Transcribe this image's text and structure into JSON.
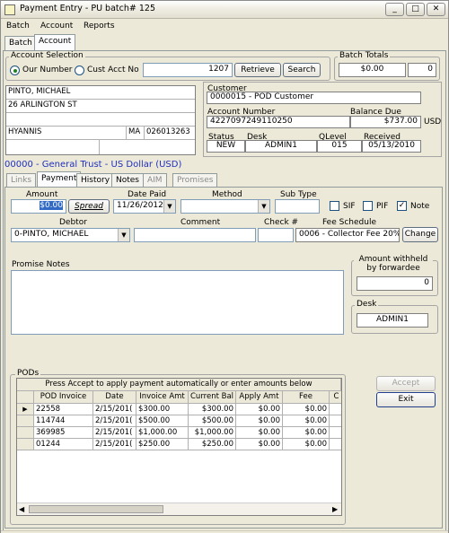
{
  "window": {
    "title": "Payment Entry - PU batch# 125",
    "minimize": "_",
    "maximize": "□",
    "close": "✕"
  },
  "menu": [
    "Batch",
    "Account",
    "Reports"
  ],
  "top_tabs": [
    "Batch",
    "Account"
  ],
  "account_selection": {
    "label": "Account Selection",
    "opt1": "Our Number",
    "opt2": "Cust Acct No",
    "value": "1207",
    "retrieve": "Retrieve",
    "search": "Search"
  },
  "batch_totals": {
    "label": "Batch Totals",
    "amount": "$0.00",
    "count": "0"
  },
  "debtor_addr": {
    "name": "PINTO, MICHAEL",
    "street": "26 ARLINGTON ST",
    "line3": "",
    "city": "HYANNIS",
    "state": "MA",
    "zip": "026013263"
  },
  "customer": {
    "label": "Customer",
    "value": "0000015 - POD Customer",
    "acct_label": "Account Number",
    "acct_value": "4227097249110250",
    "balance_label": "Balance Due",
    "balance_value": "$737.00",
    "currency": "USD",
    "status_label": "Status",
    "status_value": "NEW",
    "desk_label": "Desk",
    "desk_value": "ADMIN1",
    "qlevel_label": "QLevel",
    "qlevel_value": "015",
    "received_label": "Received",
    "received_value": "05/13/2010"
  },
  "trust": "00000 - General Trust - US Dollar (USD)",
  "subtabs": [
    "Links",
    "Payment",
    "History",
    "Notes",
    "AIM",
    "Promises"
  ],
  "payment": {
    "amount_label": "Amount",
    "amount_value": "$0.00",
    "spread": "Spread",
    "datepaid_label": "Date Paid",
    "datepaid_value": "11/26/2012",
    "method_label": "Method",
    "method_value": "",
    "subtype_label": "Sub Type",
    "subtype_value": "",
    "sif": "SIF",
    "pif": "PIF",
    "note": "Note",
    "note_check": "✓",
    "debtor_label": "Debtor",
    "debtor_value": "0-PINTO, MICHAEL",
    "comment_label": "Comment",
    "comment_value": "",
    "check_label": "Check #",
    "check_value": "",
    "fee_label": "Fee Schedule",
    "fee_value": "0006 - Collector Fee 20%",
    "change": "Change"
  },
  "promise_notes": {
    "label": "Promise Notes"
  },
  "withheld": {
    "label": "Amount withheld by forwardee",
    "value": "0"
  },
  "desk": {
    "label": "Desk",
    "value": "ADMIN1"
  },
  "pods": {
    "label": "PODs",
    "instruction": "Press Accept to apply payment automatically or enter amounts below",
    "columns": [
      "POD Invoice",
      "Date",
      "Invoice Amt",
      "Current Bal",
      "Apply Amt",
      "Fee",
      "C"
    ],
    "rows": [
      [
        "22558",
        "2/15/201(",
        "$300.00",
        "$300.00",
        "$0.00",
        "$0.00"
      ],
      [
        "114744",
        "2/15/201(",
        "$500.00",
        "$500.00",
        "$0.00",
        "$0.00"
      ],
      [
        "369985",
        "2/15/201(",
        "$1,000.00",
        "$1,000.00",
        "$0.00",
        "$0.00"
      ],
      [
        "01244",
        "2/15/201(",
        "$250.00",
        "$250.00",
        "$0.00",
        "$0.00"
      ]
    ]
  },
  "buttons": {
    "accept": "Accept",
    "exit": "Exit"
  }
}
